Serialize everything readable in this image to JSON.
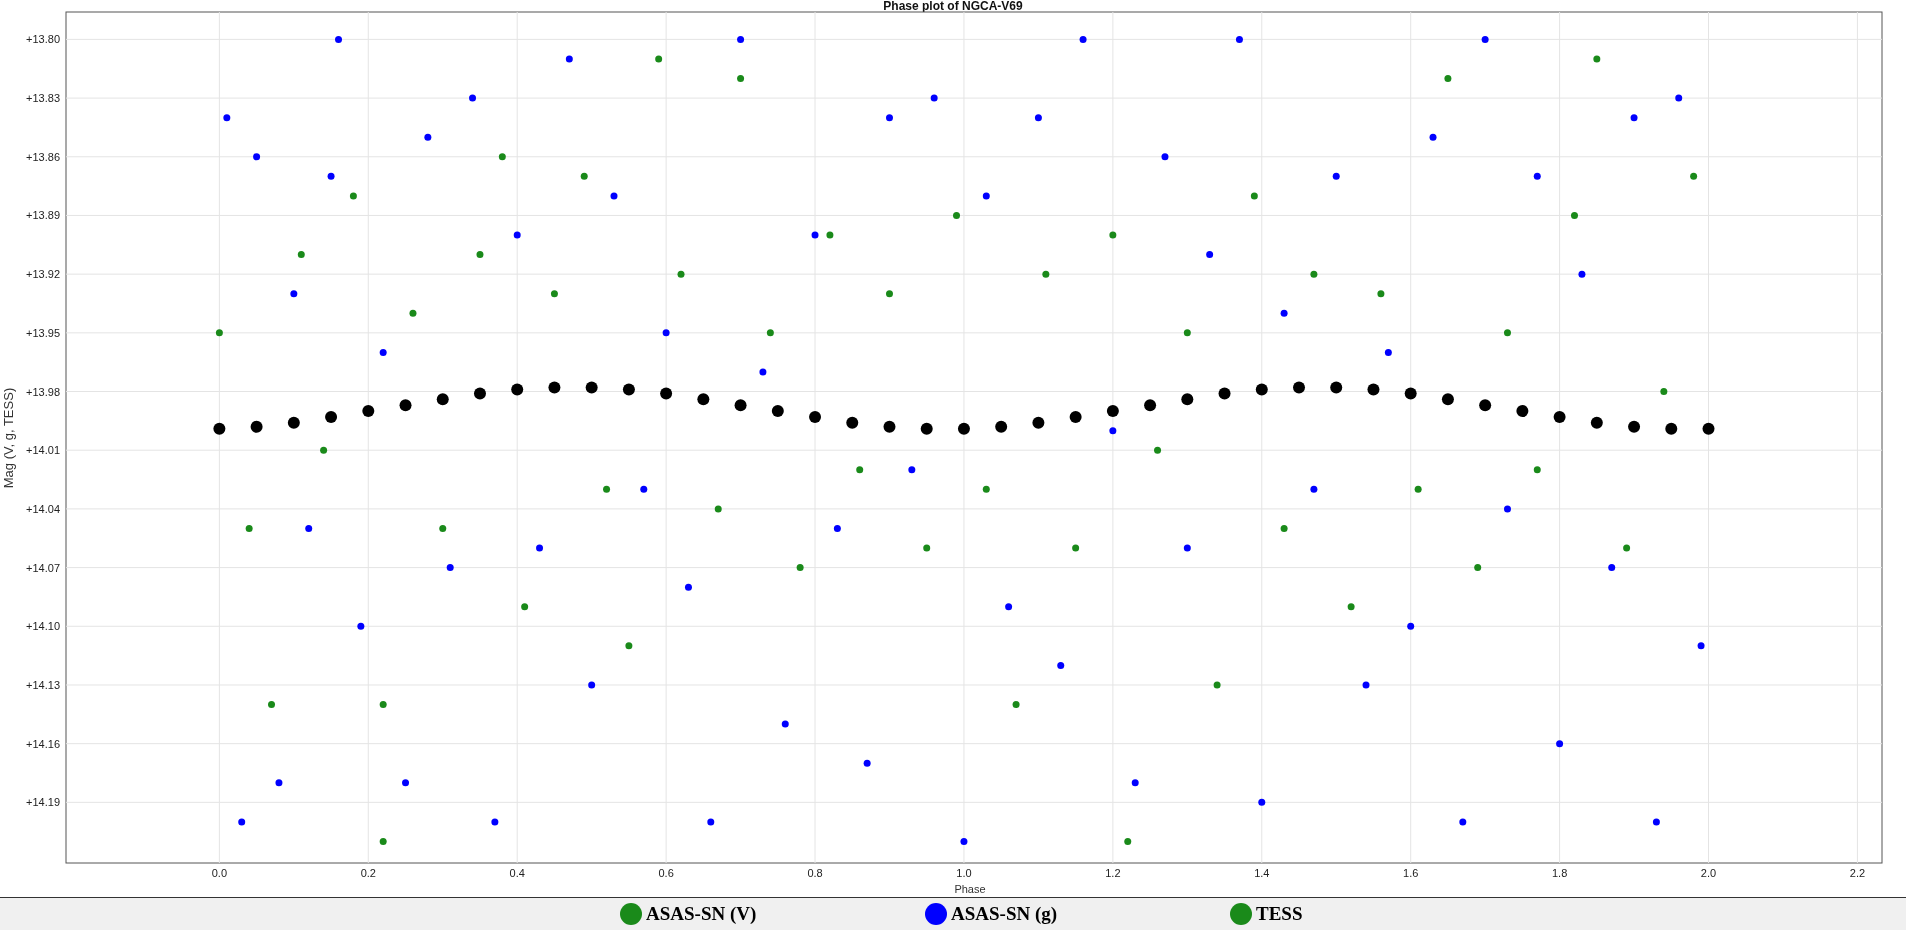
{
  "chart": {
    "chart_data": {
      "type": "scatter",
      "title": "Phase plot of NGCA-V69",
      "xlabel": "Phase",
      "ylabel": "Mag (V, g, TESS)",
      "xlim": [
        -0.206,
        2.233
      ],
      "ylim": [
        14.221,
        13.786
      ],
      "grid": true,
      "xticks": [
        {
          "value": 0,
          "label": "0.0"
        },
        {
          "value": 0.2,
          "label": "0.2"
        },
        {
          "value": 0.4,
          "label": "0.4"
        },
        {
          "value": 0.6,
          "label": "0.6"
        },
        {
          "value": 0.8,
          "label": "0.8"
        },
        {
          "value": 1,
          "label": "1.0"
        },
        {
          "value": 1.2,
          "label": "1.2"
        },
        {
          "value": 1.4,
          "label": "1.4"
        },
        {
          "value": 1.6,
          "label": "1.6"
        },
        {
          "value": 1.8,
          "label": "1.8"
        },
        {
          "value": 2,
          "label": "2.0"
        },
        {
          "value": 2.2,
          "label": "2.2"
        }
      ],
      "yticks": [
        {
          "value": 13.8,
          "label": "+13.80"
        },
        {
          "value": 13.83,
          "label": "+13.83"
        },
        {
          "value": 13.86,
          "label": "+13.86"
        },
        {
          "value": 13.89,
          "label": "+13.89"
        },
        {
          "value": 13.92,
          "label": "+13.92"
        },
        {
          "value": 13.95,
          "label": "+13.95"
        },
        {
          "value": 13.98,
          "label": "+13.98"
        },
        {
          "value": 14.01,
          "label": "+14.01"
        },
        {
          "value": 14.04,
          "label": "+14.04"
        },
        {
          "value": 14.07,
          "label": "+14.07"
        },
        {
          "value": 14.1,
          "label": "+14.10"
        },
        {
          "value": 14.13,
          "label": "+14.13"
        },
        {
          "value": 14.16,
          "label": "+14.16"
        },
        {
          "value": 14.19,
          "label": "+14.19"
        }
      ],
      "series": [
        {
          "name": "ASAS-SN (V)",
          "color": "#1a8a1a",
          "x": [
            0.0,
            0.04,
            0.07,
            0.11,
            0.14,
            0.18,
            0.22,
            0.22,
            0.26,
            0.3,
            0.35,
            0.38,
            0.41,
            0.45,
            0.49,
            0.52,
            0.55,
            0.59,
            0.62,
            0.67,
            0.7,
            0.74,
            0.78,
            0.82,
            0.86,
            0.9,
            0.95,
            0.99,
            1.03,
            1.07,
            1.11,
            1.15,
            1.2,
            1.22,
            1.26,
            1.3,
            1.34,
            1.39,
            1.43,
            1.47,
            1.52,
            1.56,
            1.61,
            1.65,
            1.69,
            1.73,
            1.77,
            1.82,
            1.85,
            1.89,
            1.94,
            1.98
          ],
          "values": [
            13.95,
            14.05,
            14.14,
            13.91,
            14.01,
            13.88,
            14.14,
            14.21,
            13.94,
            14.05,
            13.91,
            13.86,
            14.09,
            13.93,
            13.87,
            14.03,
            14.11,
            13.81,
            13.92,
            14.04,
            13.82,
            13.95,
            14.07,
            13.9,
            14.02,
            13.93,
            14.06,
            13.89,
            14.03,
            14.14,
            13.92,
            14.06,
            13.9,
            14.21,
            14.01,
            13.95,
            14.13,
            13.88,
            14.05,
            13.92,
            14.09,
            13.93,
            14.03,
            13.82,
            14.07,
            13.95,
            14.02,
            13.89,
            13.81,
            14.06,
            13.98,
            13.87
          ]
        },
        {
          "name": "ASAS-SN (g)",
          "color": "#0000ff",
          "x": [
            0.01,
            0.03,
            0.05,
            0.08,
            0.1,
            0.12,
            0.15,
            0.16,
            0.19,
            0.22,
            0.25,
            0.28,
            0.31,
            0.34,
            0.37,
            0.4,
            0.43,
            0.47,
            0.5,
            0.53,
            0.57,
            0.6,
            0.63,
            0.66,
            0.7,
            0.73,
            0.76,
            0.8,
            0.83,
            0.87,
            0.9,
            0.93,
            0.96,
            1.0,
            1.03,
            1.06,
            1.1,
            1.13,
            1.16,
            1.2,
            1.23,
            1.27,
            1.3,
            1.33,
            1.37,
            1.4,
            1.43,
            1.47,
            1.5,
            1.54,
            1.57,
            1.6,
            1.63,
            1.67,
            1.7,
            1.73,
            1.77,
            1.8,
            1.83,
            1.87,
            1.9,
            1.93,
            1.96,
            1.99
          ],
          "values": [
            13.84,
            14.2,
            13.86,
            14.18,
            13.93,
            14.05,
            13.87,
            13.8,
            14.1,
            13.96,
            14.18,
            13.85,
            14.07,
            13.83,
            14.2,
            13.9,
            14.06,
            13.81,
            14.13,
            13.88,
            14.03,
            13.95,
            14.08,
            14.2,
            13.8,
            13.97,
            14.15,
            13.9,
            14.05,
            14.17,
            13.84,
            14.02,
            13.83,
            14.21,
            13.88,
            14.09,
            13.84,
            14.12,
            13.8,
            14.0,
            14.18,
            13.86,
            14.06,
            13.91,
            13.8,
            14.19,
            13.94,
            14.03,
            13.87,
            14.13,
            13.96,
            14.1,
            13.85,
            14.2,
            13.8,
            14.04,
            13.87,
            14.16,
            13.92,
            14.07,
            13.84,
            14.2,
            13.83,
            14.11
          ]
        },
        {
          "color": "#000000",
          "x": [
            0.0,
            0.05,
            0.1,
            0.15,
            0.2,
            0.25,
            0.3,
            0.35,
            0.4,
            0.45,
            0.5,
            0.55,
            0.6,
            0.65,
            0.7,
            0.75,
            0.8,
            0.85,
            0.9,
            0.95,
            1.0,
            1.05,
            1.1,
            1.15,
            1.2,
            1.25,
            1.3,
            1.35,
            1.4,
            1.45,
            1.5,
            1.55,
            1.6,
            1.65,
            1.7,
            1.75,
            1.8,
            1.85,
            1.9,
            1.95,
            2.0
          ],
          "values": [
            13.999,
            13.998,
            13.996,
            13.993,
            13.99,
            13.987,
            13.984,
            13.981,
            13.979,
            13.978,
            13.978,
            13.979,
            13.981,
            13.984,
            13.987,
            13.99,
            13.993,
            13.996,
            13.998,
            13.999,
            13.999,
            13.998,
            13.996,
            13.993,
            13.99,
            13.987,
            13.984,
            13.981,
            13.979,
            13.978,
            13.978,
            13.979,
            13.981,
            13.984,
            13.987,
            13.99,
            13.993,
            13.996,
            13.998,
            13.999,
            13.999
          ]
        }
      ]
    }
  },
  "legend_extra": [
    {
      "label": "TESS",
      "color": "#1a8a1a"
    }
  ]
}
